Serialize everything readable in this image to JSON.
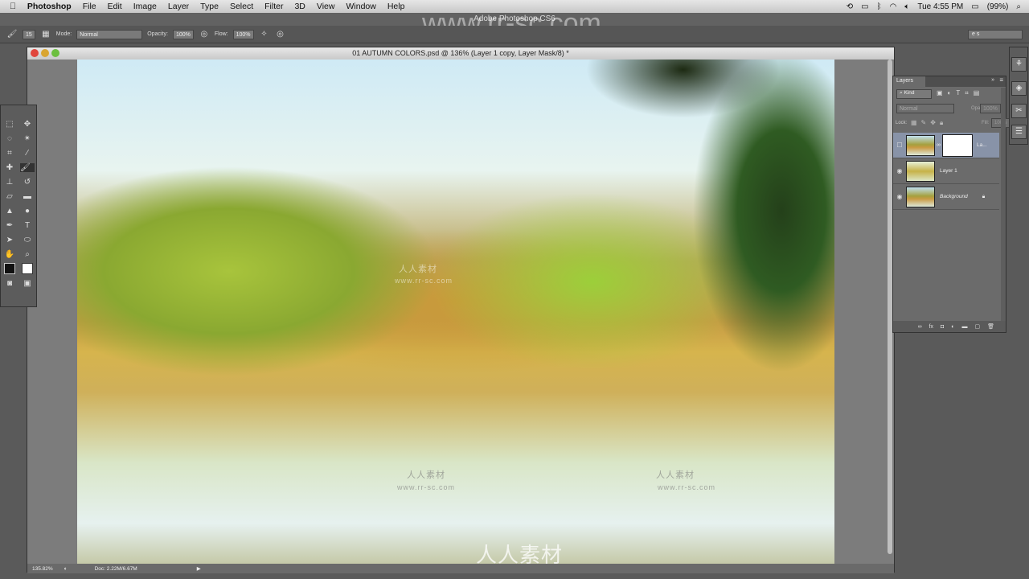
{
  "menubar": {
    "app": "Photoshop",
    "items": [
      "File",
      "Edit",
      "Image",
      "Layer",
      "Type",
      "Select",
      "Filter",
      "3D",
      "View",
      "Window",
      "Help"
    ],
    "clock": "Tue 4:55 PM",
    "battery": "(99%)"
  },
  "framebar": {
    "title": "Adobe Photoshop CS6"
  },
  "options": {
    "brush_size": "15",
    "mode_label": "Mode:",
    "mode_value": "Normal",
    "opacity_label": "Opacity:",
    "opacity_value": "100%",
    "flow_label": "Flow:",
    "flow_value": "100%",
    "workspace": "e s"
  },
  "document": {
    "title": "01 AUTUMN COLORS.psd @ 136% (Layer 1 copy, Layer Mask/8) *",
    "zoom": "135.82%",
    "doc_size": "Doc: 2.22M/6.67M"
  },
  "layers_panel": {
    "tab": "Layers",
    "filter": "Kind",
    "blend": "Normal",
    "opacity_label": "Opacity:",
    "opacity_value": "100%",
    "lock_label": "Lock:",
    "fill_label": "Fill:",
    "fill_value": "100%",
    "layers": [
      {
        "name": "La...",
        "visible": false,
        "selected": true,
        "mask": true
      },
      {
        "name": "Layer 1",
        "visible": true,
        "selected": false
      },
      {
        "name": "Background",
        "visible": true,
        "selected": false,
        "locked": true
      }
    ]
  },
  "watermarks": {
    "site": "www.rr-sc.com",
    "cn": "人人素材"
  },
  "colors": {
    "accent_selected_layer": "#8893a8"
  }
}
